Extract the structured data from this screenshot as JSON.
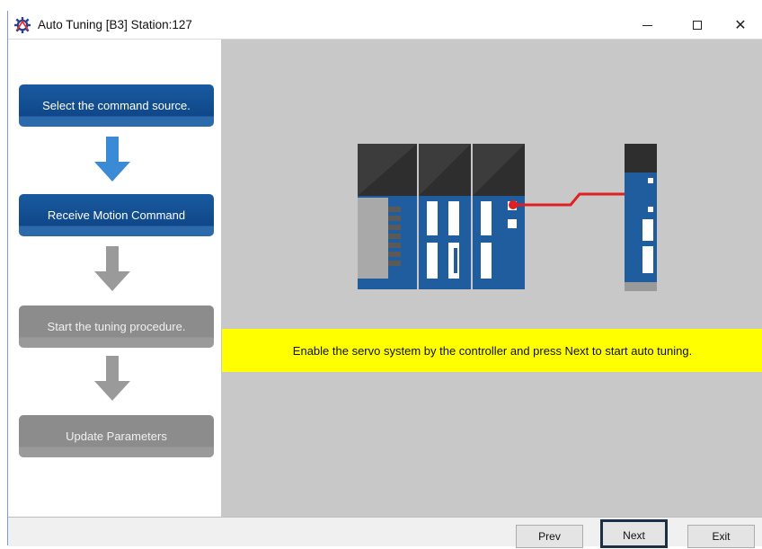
{
  "window": {
    "title": "Auto Tuning [B3] Station:127",
    "icon": "gear-tuning-icon",
    "controls": {
      "minimize": "minimize-icon",
      "maximize": "maximize-icon",
      "close": "✕"
    }
  },
  "steps": [
    {
      "label": "Select the command source.",
      "state": "active"
    },
    {
      "label": "Receive Motion Command",
      "state": "active"
    },
    {
      "label": "Start the tuning procedure.",
      "state": "inactive"
    },
    {
      "label": "Update Parameters",
      "state": "inactive"
    }
  ],
  "message": "Enable the servo system by the controller and press Next to start auto tuning.",
  "buttons": {
    "prev": "Prev",
    "next": "Next",
    "exit": "Exit"
  },
  "colors": {
    "step_active": "#0f4789",
    "step_inactive": "#8c8c8c",
    "arrow_active": "#3a8ad6",
    "arrow_inactive": "#9a9a9a",
    "message_bg": "#ffff00",
    "content_bg": "#c8c8c8",
    "connection_line": "#e02020"
  }
}
